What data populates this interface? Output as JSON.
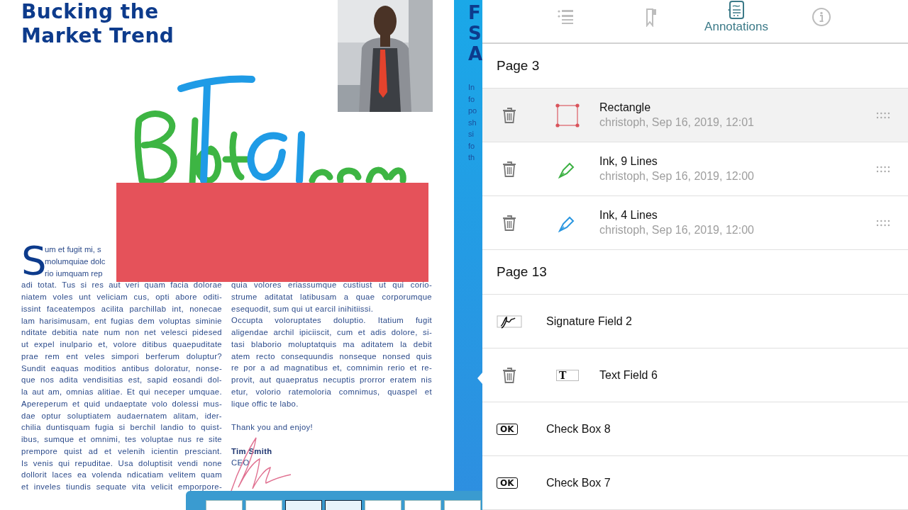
{
  "document": {
    "title_lines": [
      "Bucking the",
      "Market Trend"
    ],
    "drop_cap": "S",
    "left_column": [
      "um et fugit mi, s",
      "molumquiae dolc",
      "rio iumquam rep",
      "adi totat. Tus si res aut veri quam facia dolorae",
      "niatem voles unt veliciam cus, opti abore oditi-",
      "issint faceatempos acilita parchillab int, nonecae",
      "lam harisimusam, ent fugias dem voluptas siminie",
      "nditate debitia nate num non net velesci pidesed",
      "ut expel inulpario et, volore ditibus quaepuditate",
      "prae rem ent veles simpori berferum doluptur?",
      "Sundit eaquas moditios antibus doloratur, nonse-",
      "que nos adita vendisitias est, sapid eosandi dol-",
      "la aut am, omnias alitiae. Et qui neceper umquae.",
      "Apereperum et quid undaeptate volo dolessi mus-",
      "dae optur soluptiatem audaernatem alitam, ider-",
      "chilia duntisquam fugia si berchil landio to quist-",
      "ibus, sumque et omnimi, tes voluptae nus re site",
      "prempore quist ad et velenih icientin presciant.",
      "Is venis qui repuditae. Usa doluptisit vendi none",
      "dollorit laces ea volenda ndicatiam velitem quam",
      "et inveles tiundis sequate vita velicit emporpore-"
    ],
    "right_column": [
      "quia volores eriassumque custiust ut qui corio-",
      "strume aditatat latibusam a quae corporumque",
      "esequodit, sum qui ut earcil inihitiissi.",
      "Occupta voloruptates doluptio. Itatium fugit",
      "aligendae archil ipiciiscit, cum et adis dolore, si-",
      "tasi blaborio moluptatquis ma aditatem la debit",
      "atem recto consequundis nonseque nonsed quis",
      "re por a ad magnatibus et, comnimin rerio et re-",
      "provit, aut quaepratus necuptis prorror eratem nis",
      "etur, volorio ratemoloria comnimus, quaspel et",
      "lique offic te labo."
    ],
    "closing": "Thank you and enjoy!",
    "signer_name": "Tim Smith",
    "signer_role": "CEO",
    "next_page_title": [
      "F",
      "S",
      "A"
    ],
    "next_page_text": [
      "In",
      "fo",
      "po",
      "sh",
      "si",
      "fo",
      "th"
    ]
  },
  "thumbnails": [
    {
      "selected": false
    },
    {
      "selected": false
    },
    {
      "selected": true
    },
    {
      "selected": true
    },
    {
      "selected": false
    },
    {
      "selected": false
    },
    {
      "selected": false
    }
  ],
  "tabs": [
    {
      "kind": "outline",
      "selected": false
    },
    {
      "kind": "bookmarks",
      "selected": false
    },
    {
      "kind": "annotations",
      "label": "Annotations",
      "selected": true
    },
    {
      "kind": "info",
      "selected": false
    }
  ],
  "sections": [
    {
      "title": "Page 3",
      "items": [
        {
          "kind": "rectangle",
          "name": "Rectangle",
          "meta": "christoph, Sep 16, 2019, 12:01",
          "deletable": true,
          "draggable": true,
          "selected": true
        },
        {
          "kind": "ink-green",
          "name": "Ink, 9 Lines",
          "meta": "christoph, Sep 16, 2019, 12:00",
          "deletable": true,
          "draggable": true,
          "selected": false
        },
        {
          "kind": "ink-blue",
          "name": "Ink, 4 Lines",
          "meta": "christoph, Sep 16, 2019, 12:00",
          "deletable": true,
          "draggable": true,
          "selected": false
        }
      ]
    },
    {
      "title": "Page 13",
      "items": [
        {
          "kind": "signature",
          "name": "Signature Field 2",
          "deletable": false,
          "draggable": false,
          "selected": false
        },
        {
          "kind": "text",
          "name": "Text Field 6",
          "icon_text": "T",
          "deletable": true,
          "draggable": false,
          "selected": false
        },
        {
          "kind": "checkbox",
          "name": "Check Box 8",
          "icon_text": "OK",
          "deletable": false,
          "draggable": false,
          "selected": false
        },
        {
          "kind": "checkbox",
          "name": "Check Box 7",
          "icon_text": "OK",
          "deletable": false,
          "draggable": false,
          "selected": false
        }
      ]
    }
  ]
}
